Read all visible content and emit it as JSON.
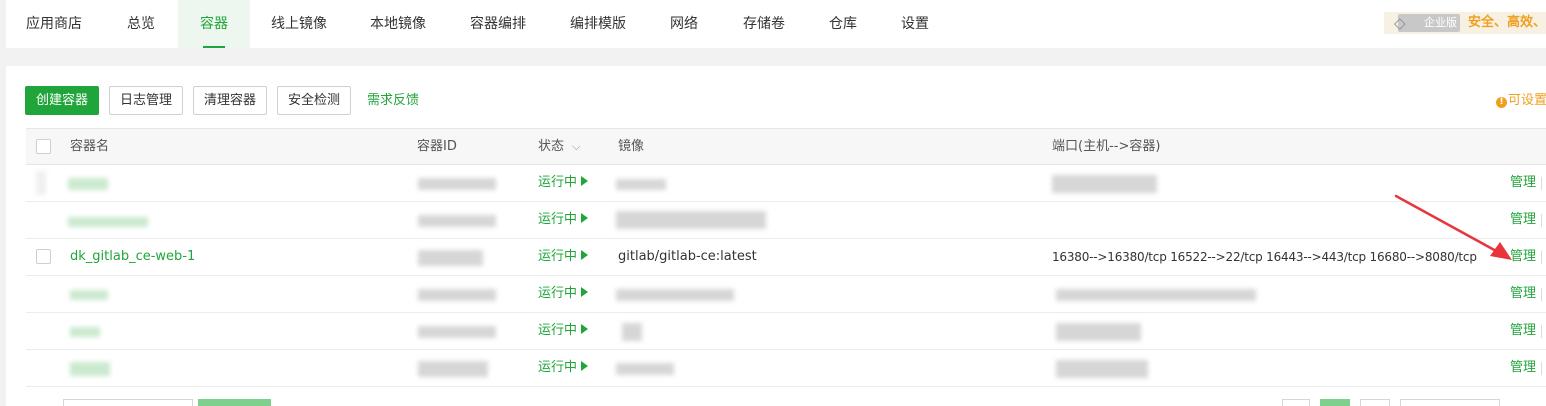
{
  "nav": {
    "tabs": [
      {
        "label": "应用商店",
        "active": false
      },
      {
        "label": "总览",
        "active": false
      },
      {
        "label": "容器",
        "active": true
      },
      {
        "label": "线上镜像",
        "active": false
      },
      {
        "label": "本地镜像",
        "active": false
      },
      {
        "label": "容器编排",
        "active": false
      },
      {
        "label": "编排模版",
        "active": false
      },
      {
        "label": "网络",
        "active": false
      },
      {
        "label": "存储卷",
        "active": false
      },
      {
        "label": "仓库",
        "active": false
      },
      {
        "label": "设置",
        "active": false
      }
    ],
    "enterprise_badge": "企业版",
    "enterprise_slogan": "安全、高效、让"
  },
  "toolbar": {
    "create_label": "创建容器",
    "logs_label": "日志管理",
    "clean_label": "清理容器",
    "security_label": "安全检测",
    "feedback_label": "需求反馈",
    "tip_label": "可设置"
  },
  "table": {
    "headers": {
      "name": "容器名",
      "id": "容器ID",
      "status": "状态",
      "image": "镜像",
      "ports": "端口(主机-->容器)"
    },
    "rows": [
      {
        "name": "",
        "status": "运行中",
        "image": "",
        "ports": "",
        "action": "管理",
        "redacted": true
      },
      {
        "name": "",
        "status": "运行中",
        "image": "",
        "ports": "",
        "action": "管理",
        "redacted": true
      },
      {
        "name": "dk_gitlab_ce-web-1",
        "status": "运行中",
        "image": "gitlab/gitlab-ce:latest",
        "ports": "16380-->16380/tcp 16522-->22/tcp 16443-->443/tcp 16680-->8080/tcp",
        "action": "管理",
        "redacted": false
      },
      {
        "name": "",
        "status": "运行中",
        "image": "",
        "ports": "",
        "action": "管理",
        "redacted": true
      },
      {
        "name": "",
        "status": "运行中",
        "image": "",
        "ports": "",
        "action": "管理",
        "redacted": true
      },
      {
        "name": "",
        "status": "运行中",
        "image": "",
        "ports": "",
        "action": "管理",
        "redacted": true
      }
    ]
  },
  "colors": {
    "accent": "#20a53a",
    "warning": "#f0a020",
    "annotation_arrow": "#e8343b"
  }
}
